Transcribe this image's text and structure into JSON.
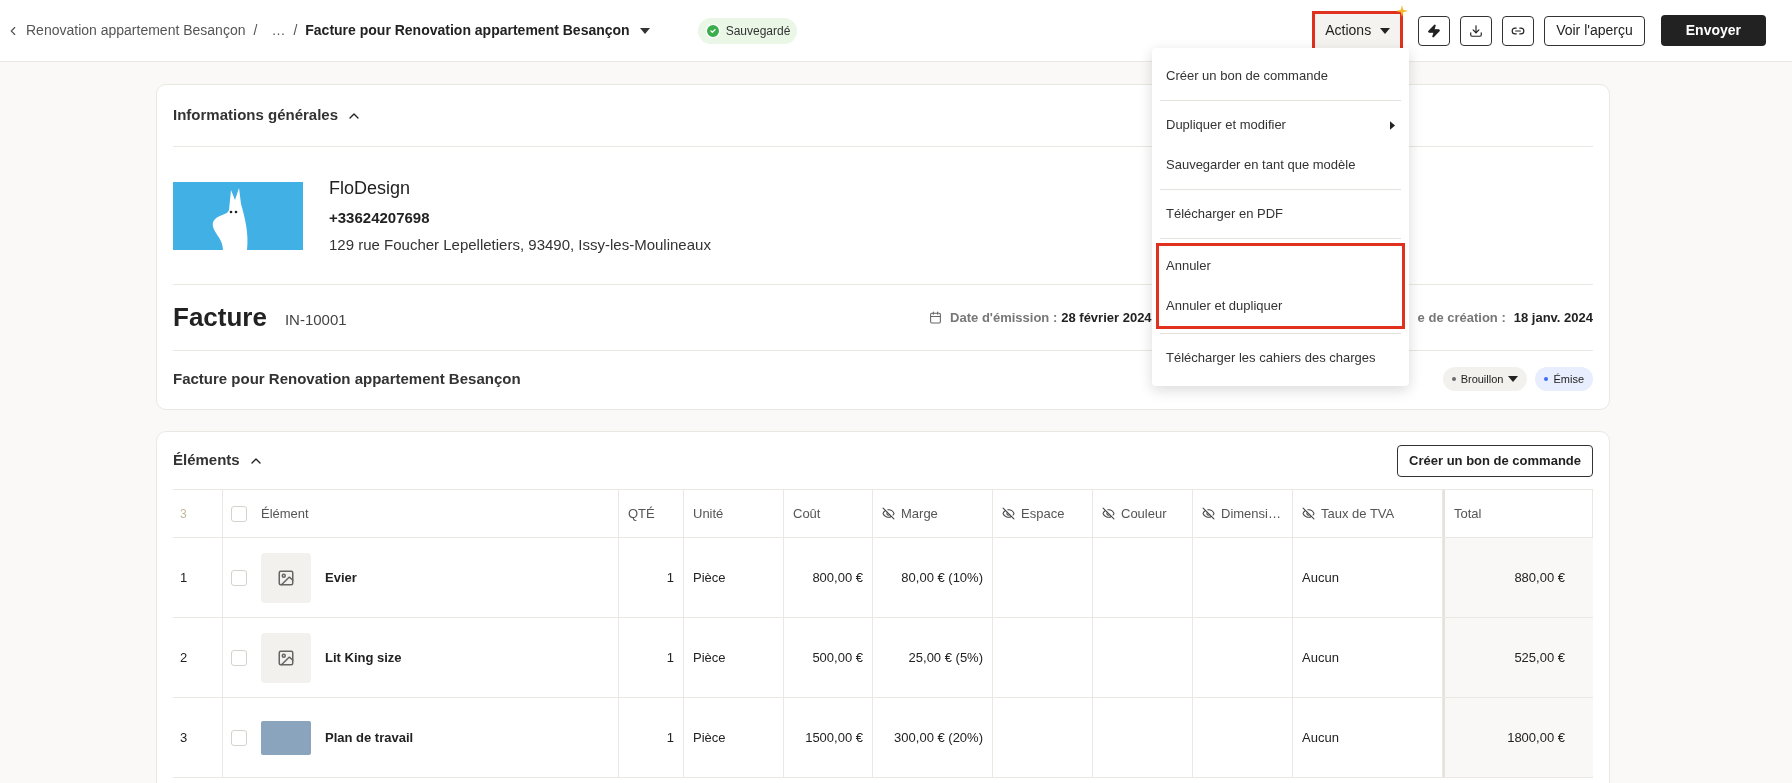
{
  "breadcrumb": {
    "items": [
      "Renovation appartement Besançon",
      "…"
    ],
    "separators": [
      "/",
      "/"
    ],
    "current": "Facture pour Renovation appartement Besançon"
  },
  "save_status": "Sauvegardé",
  "toolbar": {
    "actions": {
      "label": "Actions",
      "highlighted": true
    },
    "preview": "Voir l'aperçu",
    "send": "Envoyer"
  },
  "actions_menu": {
    "groups": [
      {
        "highlighted": false,
        "items": [
          {
            "label": "Créer un bon de commande",
            "submenu": false
          }
        ]
      },
      {
        "highlighted": false,
        "items": [
          {
            "label": "Dupliquer et modifier",
            "submenu": true
          },
          {
            "label": "Sauvegarder en tant que modèle",
            "submenu": false
          }
        ]
      },
      {
        "highlighted": false,
        "items": [
          {
            "label": "Télécharger en PDF",
            "submenu": false
          }
        ]
      },
      {
        "highlighted": true,
        "items": [
          {
            "label": "Annuler",
            "submenu": false
          },
          {
            "label": "Annuler et dupliquer",
            "submenu": false
          }
        ]
      },
      {
        "highlighted": false,
        "items": [
          {
            "label": "Télécharger les cahiers des charges",
            "submenu": false
          }
        ]
      }
    ]
  },
  "general_info": {
    "title": "Informations générales",
    "expanded": true,
    "company": {
      "name": "FloDesign",
      "phone": "+33624207698",
      "address": "129 rue Foucher Lepelletiers, 93490, Issy-les-Moulineaux"
    },
    "document": {
      "type": "Facture",
      "number": "IN-10001",
      "issue_label": "Date d'émission :",
      "issue_date": "28 février 2024",
      "created_label": "e de création :",
      "created_date": "18 janv. 2024"
    },
    "description": "Facture pour Renovation appartement Besançon",
    "statuses": [
      {
        "label": "Brouillon",
        "color": "#6b6b6b",
        "dropdown": true
      },
      {
        "label": "Émise",
        "color": "#3b6ef5",
        "dropdown": false
      }
    ]
  },
  "elements": {
    "title": "Éléments",
    "expanded": true,
    "create_button": "Créer un bon de commande",
    "table": {
      "count": "3",
      "all_checked": false,
      "columns": [
        {
          "label": "Élément",
          "hidden": false
        },
        {
          "label": "QTÉ",
          "hidden": false
        },
        {
          "label": "Unité",
          "hidden": false
        },
        {
          "label": "Coût",
          "hidden": false
        },
        {
          "label": "Marge",
          "hidden": true
        },
        {
          "label": "Espace",
          "hidden": true
        },
        {
          "label": "Couleur",
          "hidden": true
        },
        {
          "label": "Dimensi…",
          "hidden": true
        },
        {
          "label": "Taux de TVA",
          "hidden": true
        },
        {
          "label": "Total",
          "hidden": false
        }
      ],
      "rows": [
        {
          "index": "1",
          "checked": false,
          "kind": "placeholder",
          "name": "Evier",
          "qty": "1",
          "unit": "Pièce",
          "cost": "800,00 €",
          "margin": "80,00 € (10%)",
          "vat": "Aucun",
          "total": "880,00 €"
        },
        {
          "index": "2",
          "checked": false,
          "kind": "placeholder",
          "name": "Lit King size",
          "qty": "1",
          "unit": "Pièce",
          "cost": "500,00 €",
          "margin": "25,00 € (5%)",
          "vat": "Aucun",
          "total": "525,00 €"
        },
        {
          "index": "3",
          "checked": false,
          "kind": "photo",
          "name": "Plan de travail",
          "qty": "1",
          "unit": "Pièce",
          "cost": "1500,00 €",
          "margin": "300,00 € (20%)",
          "vat": "Aucun",
          "total": "1800,00 €"
        }
      ]
    }
  }
}
